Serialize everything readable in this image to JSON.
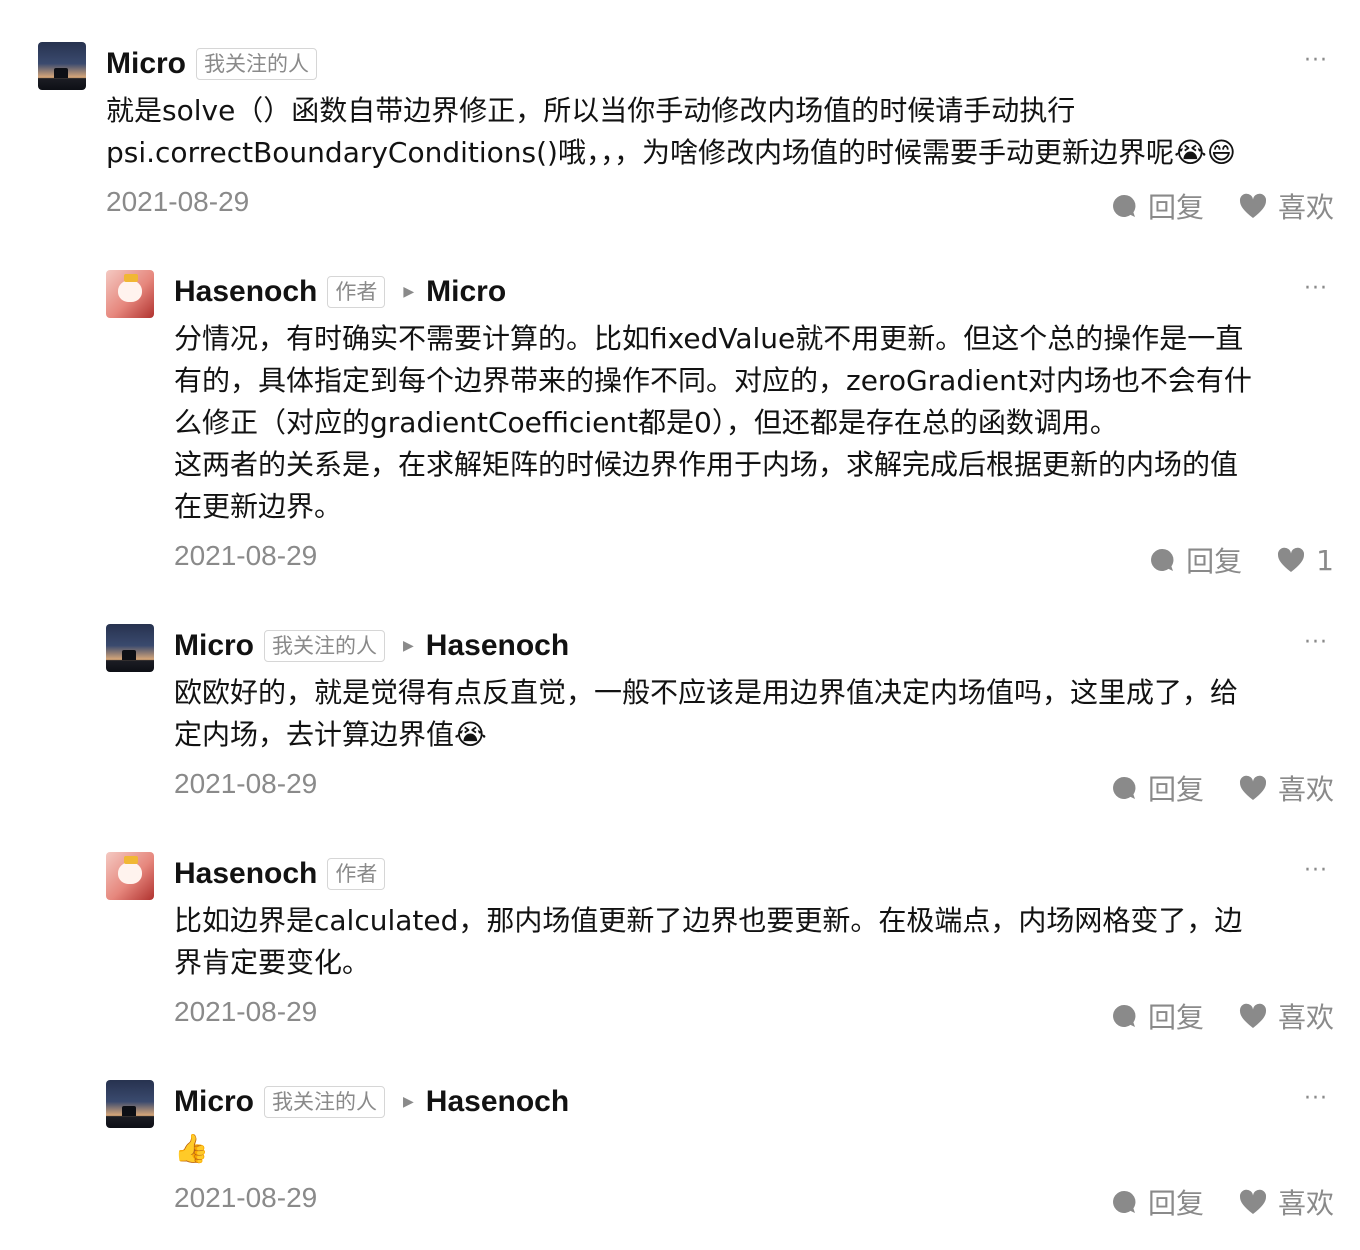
{
  "comments": [
    {
      "author": "Micro",
      "tag": "我关注的人",
      "reply_to": "",
      "text": "就是solve（）函数自带边界修正，所以当你手动修改内场值的时候请手动执行\npsi.correctBoundaryConditions()哦，，，为啥修改内场值的时候需要手动更新边界呢",
      "emoji": "😭😄",
      "date": "2021-08-29",
      "reply_label": "回复",
      "like_label": "喜欢",
      "more": "···"
    },
    {
      "author": "Hasenoch",
      "tag": "作者",
      "reply_to": "Micro",
      "text": "分情况，有时确实不需要计算的。比如fixedValue就不用更新。但这个总的操作是一直\n有的，具体指定到每个边界带来的操作不同。对应的，zeroGradient对内场也不会有什\n么修正（对应的gradientCoefficient都是0），但还都是存在总的函数调用。\n这两者的关系是，在求解矩阵的时候边界作用于内场，求解完成后根据更新的内场的值\n在更新边界。",
      "emoji": "",
      "date": "2021-08-29",
      "reply_label": "回复",
      "like_label": "1",
      "more": "···"
    },
    {
      "author": "Micro",
      "tag": "我关注的人",
      "reply_to": "Hasenoch",
      "text": "欧欧好的，就是觉得有点反直觉，一般不应该是用边界值决定内场值吗，这里成了，给\n定内场，去计算边界值",
      "emoji": "😭",
      "date": "2021-08-29",
      "reply_label": "回复",
      "like_label": "喜欢",
      "more": "···"
    },
    {
      "author": "Hasenoch",
      "tag": "作者",
      "reply_to": "",
      "text": "比如边界是calculated，那内场值更新了边界也要更新。在极端点，内场网格变了，边\n界肯定要变化。",
      "emoji": "",
      "date": "2021-08-29",
      "reply_label": "回复",
      "like_label": "喜欢",
      "more": "···"
    },
    {
      "author": "Micro",
      "tag": "我关注的人",
      "reply_to": "Hasenoch",
      "text": "",
      "emoji": "👍",
      "date": "2021-08-29",
      "reply_label": "回复",
      "like_label": "喜欢",
      "more": "···"
    }
  ]
}
